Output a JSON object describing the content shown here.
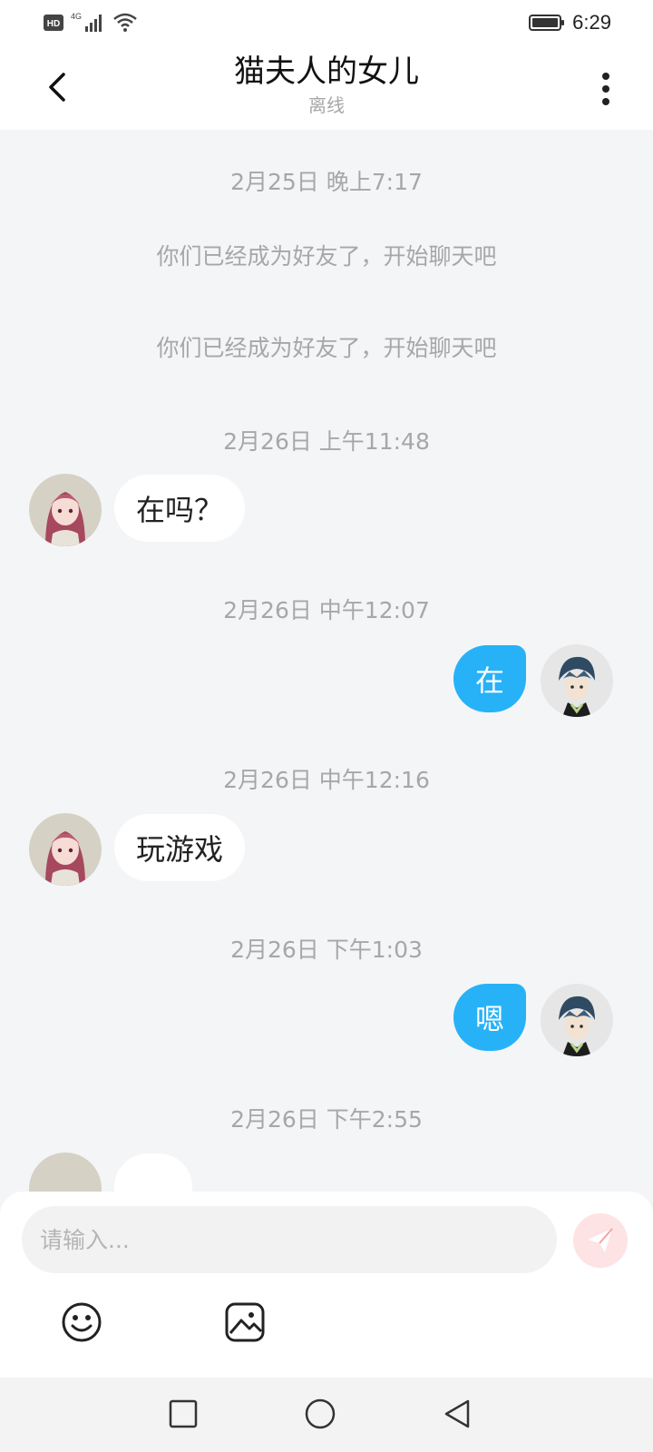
{
  "status_bar": {
    "hd_label": "HD",
    "network_label": "4G",
    "time": "6:29"
  },
  "header": {
    "title": "猫夫人的女儿",
    "subtitle": "离线"
  },
  "chat": {
    "timestamps": [
      "2月25日 晚上7:17",
      "2月26日 上午11:48",
      "2月26日 中午12:07",
      "2月26日 中午12:16",
      "2月26日 下午1:03",
      "2月26日 下午2:55"
    ],
    "system_messages": [
      "你们已经成为好友了，开始聊天吧",
      "你们已经成为好友了，开始聊天吧"
    ],
    "messages": [
      {
        "sender": "other",
        "text": "在吗？"
      },
      {
        "sender": "self",
        "text": "在"
      },
      {
        "sender": "other",
        "text": "玩游戏"
      },
      {
        "sender": "self",
        "text": "嗯"
      }
    ]
  },
  "composer": {
    "placeholder": "请输入..."
  },
  "colors": {
    "accent": "#27b2f8",
    "background": "#f4f5f7",
    "send_disabled": "#fde3e3",
    "send_icon": "#f6a3a3"
  },
  "icons": {
    "back": "chevron-left-icon",
    "more": "more-vertical-icon",
    "send": "send-icon",
    "emoji": "emoji-icon",
    "image": "image-icon"
  }
}
